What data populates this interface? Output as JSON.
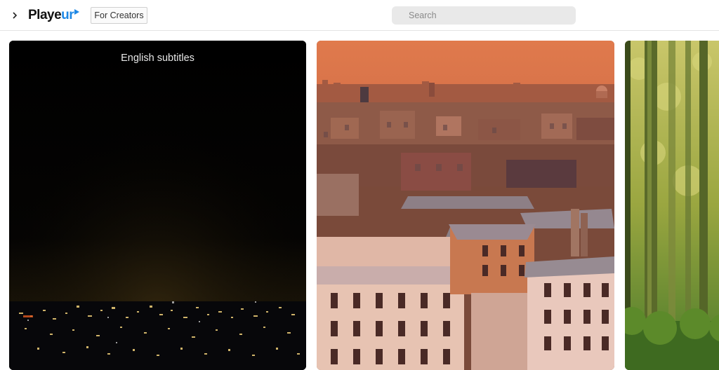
{
  "header": {
    "logo": {
      "main": "Playe",
      "accent": "ur"
    },
    "creators_label": "For Creators",
    "search_placeholder": "Search",
    "colors": {
      "logo_accent": "#1e88e5",
      "search_bg": "#e9e9e9"
    }
  },
  "cards": [
    {
      "subtitle": "English subtitles",
      "image": "paris-night-skyline"
    },
    {
      "image": "paris-rooftops-orange-sky"
    },
    {
      "image": "green-forest"
    }
  ]
}
